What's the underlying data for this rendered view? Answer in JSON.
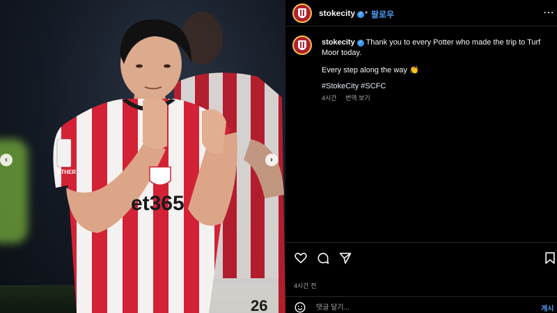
{
  "post": {
    "username": "stokecity",
    "follow_label": "팔로우",
    "dot": "•",
    "more_label": "⋯",
    "caption_line1": "Thank you to every Potter who made the trip to Turf Moor today.",
    "caption_line2": "Every step along the way 👏",
    "hashtags": "#StokeCity #SCFC",
    "caption_time": "4시간",
    "translate_label": "번역 보기",
    "timestamp": "4시간 전",
    "comment_placeholder": "댓글 달기...",
    "post_label": "게시"
  },
  "media": {
    "shirt_sponsor": "et365",
    "sleeve_text": "ETHER",
    "back_number": "26",
    "prev_glyph": "‹",
    "next_glyph": "›"
  },
  "colors": {
    "accent": "#4ea1f7",
    "verified": "#3897f0",
    "stoke_red": "#d32235"
  },
  "icons": [
    "heart-icon",
    "comment-icon",
    "share-icon",
    "bookmark-icon",
    "emoji-icon",
    "verified-badge-icon"
  ]
}
